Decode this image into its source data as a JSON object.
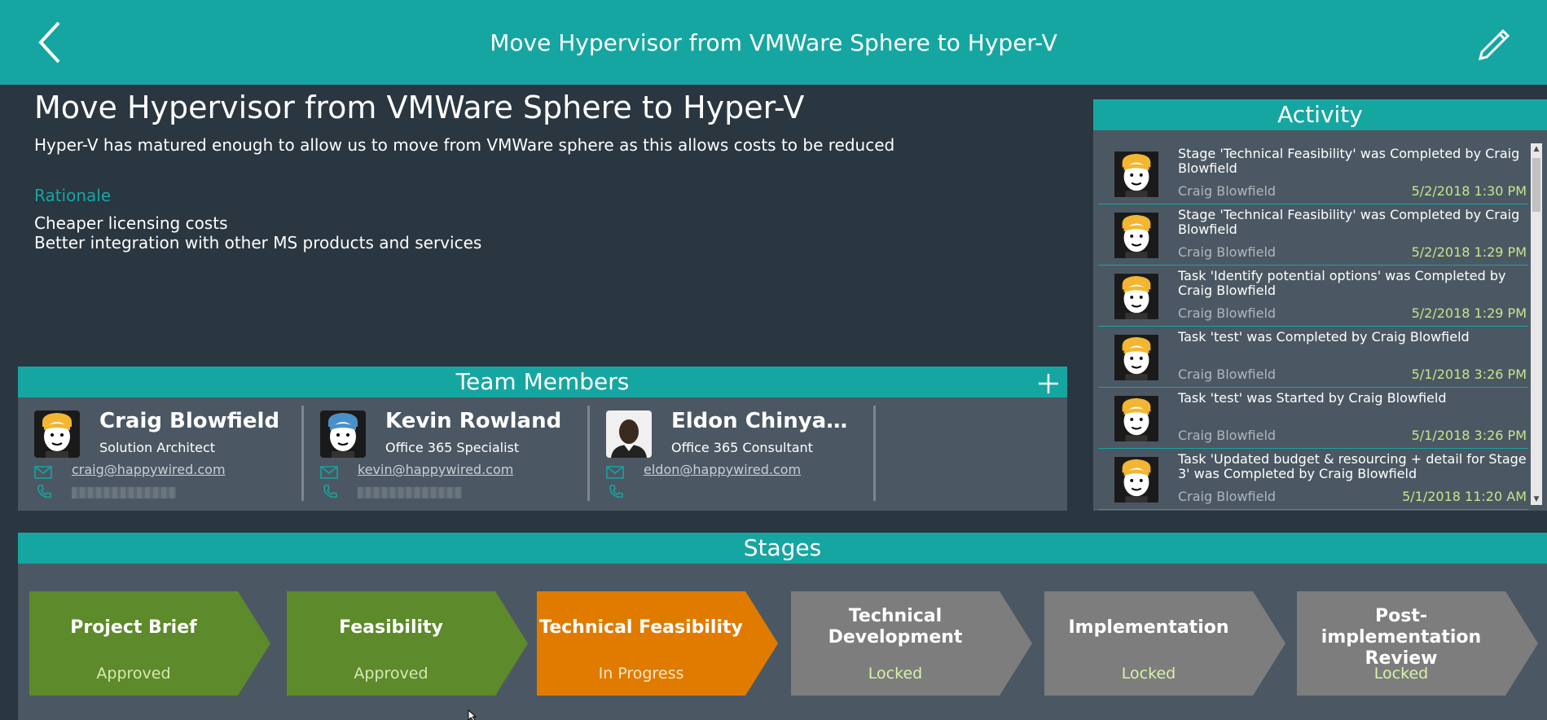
{
  "header": {
    "title": "Move Hypervisor from VMWare Sphere to Hyper-V",
    "back_icon": "chevron-left-icon",
    "edit_icon": "pencil-icon"
  },
  "project": {
    "title": "Move Hypervisor from VMWare Sphere to Hyper-V",
    "description": "Hyper-V has matured enough to allow us to move from VMWare sphere as this allows costs to be reduced",
    "rationale_label": "Rationale",
    "rationale": [
      "Cheaper licensing costs",
      "Better integration with other MS products and services"
    ]
  },
  "team": {
    "title": "Team Members",
    "add_icon": "plus-icon",
    "members": [
      {
        "name": "Craig Blowfield",
        "role": "Solution Architect",
        "email": "craig@happywired.com"
      },
      {
        "name": "Kevin Rowland",
        "role": "Office 365 Specialist",
        "email": "kevin@happywired.com"
      },
      {
        "name": "Eldon Chinyamako...",
        "role": "Office 365 Consultant",
        "email": "eldon@happywired.com"
      }
    ]
  },
  "activity": {
    "title": "Activity",
    "items": [
      {
        "text": "Stage 'Technical Feasibility' was Completed by Craig Blowfield",
        "who": "Craig Blowfield",
        "when": "5/2/2018 1:30 PM"
      },
      {
        "text": "Stage 'Technical Feasibility' was Completed by Craig Blowfield",
        "who": "Craig Blowfield",
        "when": "5/2/2018 1:29 PM"
      },
      {
        "text": "Task 'Identify potential options' was Completed by Craig Blowfield",
        "who": "Craig Blowfield",
        "when": "5/2/2018 1:29 PM"
      },
      {
        "text": "Task 'test' was Completed by Craig Blowfield",
        "who": "Craig Blowfield",
        "when": "5/1/2018 3:26 PM"
      },
      {
        "text": "Task 'test' was Started by Craig Blowfield",
        "who": "Craig Blowfield",
        "when": "5/1/2018 3:26 PM"
      },
      {
        "text": "Task 'Updated budget & resourcing + detail for Stage 3' was Completed by Craig Blowfield",
        "who": "Craig Blowfield",
        "when": "5/1/2018 11:20 AM"
      }
    ]
  },
  "stages": {
    "title": "Stages",
    "items": [
      {
        "name": "Project Brief",
        "status": "Approved",
        "color": "#5d8a2a",
        "status_color": "#d8e8b8"
      },
      {
        "name": "Feasibility",
        "status": "Approved",
        "color": "#5d8a2a",
        "status_color": "#d8e8b8"
      },
      {
        "name": "Technical Feasibility",
        "status": "In Progress",
        "color": "#e07b00",
        "status_color": "#fde6c4"
      },
      {
        "name": "Technical Development",
        "status": "Locked",
        "color": "#7d7d7d",
        "status_color": "#d8f2a8"
      },
      {
        "name": "Implementation",
        "status": "Locked",
        "color": "#7d7d7d",
        "status_color": "#d8f2a8"
      },
      {
        "name": "Post-implementation Review",
        "status": "Locked",
        "color": "#7d7d7d",
        "status_color": "#d8f2a8"
      }
    ]
  },
  "colors": {
    "accent": "#16a6a2",
    "background": "#2a3640",
    "panel": "#4b5863"
  }
}
